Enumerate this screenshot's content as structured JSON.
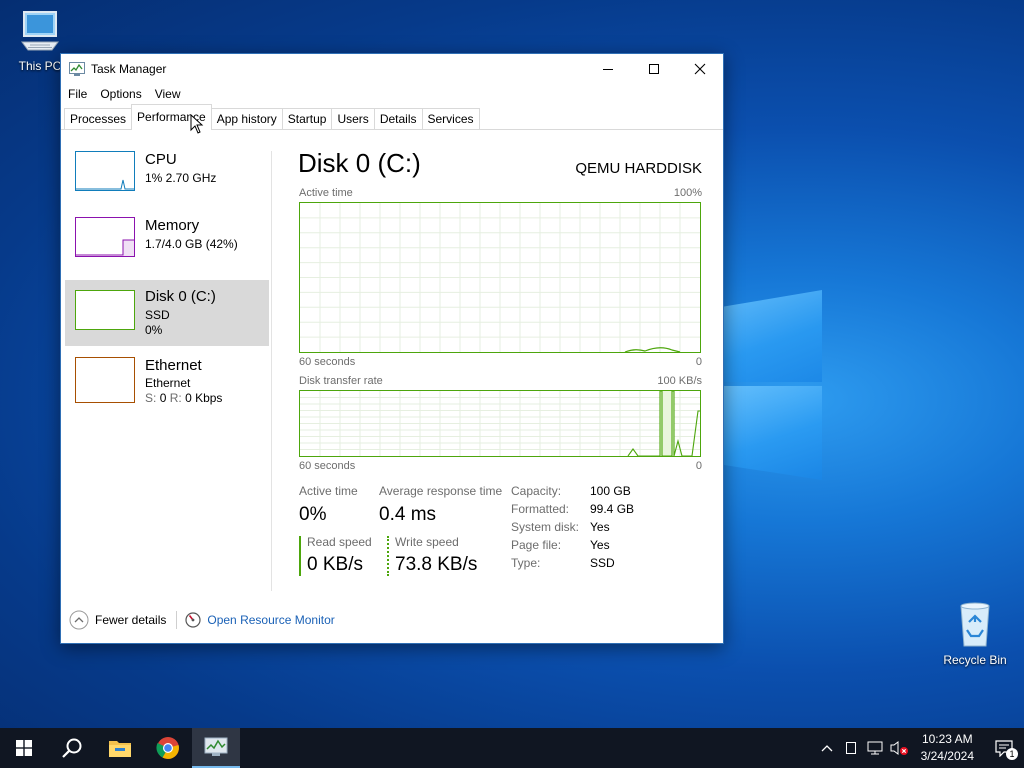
{
  "desktop": {
    "icons": [
      {
        "label": "This PC",
        "icon": "this-pc-icon"
      },
      {
        "label": "Recycle Bin",
        "icon": "recycle-bin-icon"
      }
    ]
  },
  "window": {
    "title": "Task Manager",
    "controls": [
      "minimize",
      "maximize",
      "close"
    ]
  },
  "menu": [
    "File",
    "Options",
    "View"
  ],
  "tabs": [
    "Processes",
    "Performance",
    "App history",
    "Startup",
    "Users",
    "Details",
    "Services"
  ],
  "active_tab": "Performance",
  "sidebar": [
    {
      "name": "CPU",
      "line1": "1% 2.70 GHz",
      "line2": "",
      "color": "#117dbb"
    },
    {
      "name": "Memory",
      "line1": "1.7/4.0 GB (42%)",
      "line2": "",
      "color": "#8b12ae"
    },
    {
      "name": "Disk 0 (C:)",
      "line1": "SSD",
      "line2": "0%",
      "color": "#4da60c"
    },
    {
      "name": "Ethernet",
      "line1": "Ethernet",
      "line2_label1": "S:",
      "line2_val1": "0",
      "line2_label2": "R:",
      "line2_val2": "0 Kbps",
      "color": "#a74f01"
    }
  ],
  "detail": {
    "title": "Disk 0 (C:)",
    "device": "QEMU HARDDISK",
    "graph1": {
      "label": "Active time",
      "max": "100%",
      "time": "60 seconds",
      "min": "0"
    },
    "graph2": {
      "label": "Disk transfer rate",
      "max": "100 KB/s",
      "time": "60 seconds",
      "min": "0"
    },
    "stats": {
      "active_time_label": "Active time",
      "active_time": "0%",
      "avg_response_label": "Average response time",
      "avg_response": "0.4 ms",
      "read_label": "Read speed",
      "read": "0 KB/s",
      "write_label": "Write speed",
      "write": "73.8 KB/s"
    },
    "props": [
      {
        "k": "Capacity:",
        "v": "100 GB"
      },
      {
        "k": "Formatted:",
        "v": "99.4 GB"
      },
      {
        "k": "System disk:",
        "v": "Yes"
      },
      {
        "k": "Page file:",
        "v": "Yes"
      },
      {
        "k": "Type:",
        "v": "SSD"
      }
    ]
  },
  "footer": {
    "fewer_details": "Fewer details",
    "open_resource_monitor": "Open Resource Monitor"
  },
  "taskbar": {
    "time": "10:23 AM",
    "date": "3/24/2024",
    "notification_count": "1"
  }
}
